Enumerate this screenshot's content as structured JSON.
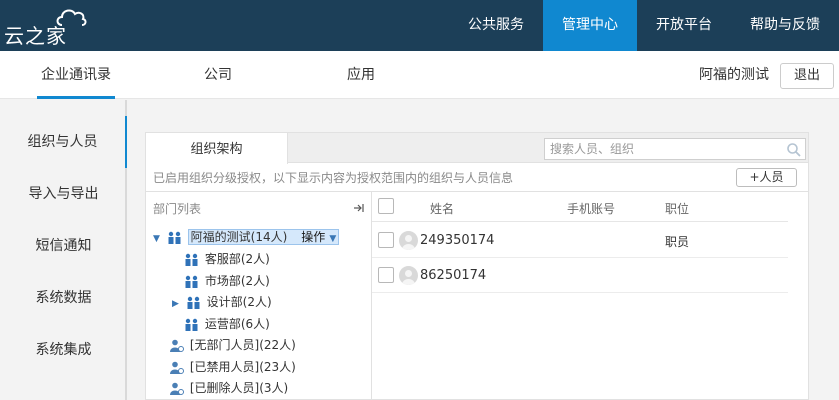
{
  "brand": {
    "name": "云之家"
  },
  "topnav": {
    "items": [
      "公共服务",
      "管理中心",
      "开放平台",
      "帮助与反馈"
    ]
  },
  "subnav": {
    "tabs": [
      "企业通讯录",
      "公司",
      "应用"
    ],
    "user": "阿福的测试",
    "logout_label": "退出"
  },
  "leftmenu": {
    "items": [
      "组织与人员",
      "导入与导出",
      "短信通知",
      "系统数据",
      "系统集成"
    ]
  },
  "panel": {
    "tab_label": "组织架构",
    "search_placeholder": "搜索人员、组织",
    "hint": "已启用组织分级授权，以下显示内容为授权范围内的组织与人员信息",
    "add_person_label": "+人员",
    "tree": {
      "title": "部门列表",
      "root": "阿福的测试(14人)",
      "operate_label": "操作",
      "depts": [
        "客服部(2人)",
        "市场部(2人)",
        "设计部(2人)",
        "运营部(6人)"
      ],
      "special": [
        "[无部门人员](22人)",
        "[已禁用人员](23人)",
        "[已删除人员](3人)"
      ]
    },
    "list": {
      "columns": [
        "姓名",
        "手机账号",
        "职位"
      ],
      "rows": [
        {
          "name": "249350174",
          "phone": "",
          "position": "职员"
        },
        {
          "name": "86250174",
          "phone": "",
          "position": ""
        }
      ]
    }
  },
  "colors": {
    "topbar": "#1c3f58",
    "accent": "#1088d0"
  }
}
